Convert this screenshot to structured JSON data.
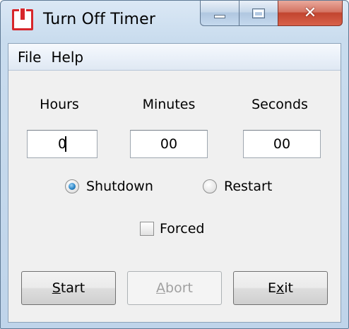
{
  "window": {
    "title": "Turn Off Timer",
    "icon": "power-icon",
    "caption_buttons": {
      "minimize_glyph": "",
      "maximize_glyph": "",
      "close_glyph": "✕"
    }
  },
  "menu": {
    "items": [
      {
        "label": "File"
      },
      {
        "label": "Help"
      }
    ]
  },
  "fields": {
    "hours": {
      "label": "Hours",
      "value": "0"
    },
    "minutes": {
      "label": "Minutes",
      "value": "00"
    },
    "seconds": {
      "label": "Seconds",
      "value": "00"
    }
  },
  "mode": {
    "shutdown": {
      "label": "Shutdown",
      "checked": true
    },
    "restart": {
      "label": "Restart",
      "checked": false
    }
  },
  "forced": {
    "label": "Forced",
    "checked": false
  },
  "buttons": {
    "start": {
      "mnemonic": "S",
      "rest": "tart",
      "enabled": true
    },
    "abort": {
      "mnemonic": "A",
      "rest": "bort",
      "enabled": false
    },
    "exit": {
      "mnemonic": "x",
      "prefix": "E",
      "rest": "it",
      "enabled": true
    }
  },
  "colors": {
    "icon_red": "#d7262b",
    "close_button": "#c2452f",
    "radio_selected": "#2c87c9"
  }
}
